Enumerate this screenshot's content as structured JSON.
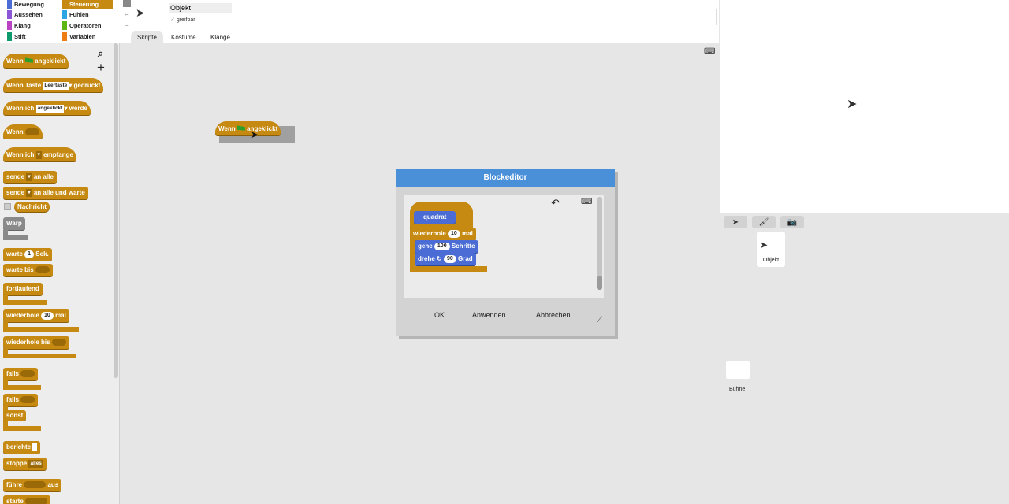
{
  "categories": [
    {
      "label": "Bewegung",
      "color": "#4a6cd4"
    },
    {
      "label": "Steuerung",
      "color": "#c68a12",
      "selected": true
    },
    {
      "label": "Aussehen",
      "color": "#8a55d7"
    },
    {
      "label": "Fühlen",
      "color": "#2ca5e2"
    },
    {
      "label": "Klang",
      "color": "#bb42c3"
    },
    {
      "label": "Operatoren",
      "color": "#5cb712"
    },
    {
      "label": "Stift",
      "color": "#0e9a6c"
    },
    {
      "label": "Variablen",
      "color": "#ee7d16"
    }
  ],
  "sprite": {
    "name": "Objekt",
    "draggable_label": "greifbar"
  },
  "tabs": [
    "Skripte",
    "Kostüme",
    "Klänge"
  ],
  "palette": {
    "when_flag": {
      "pre": "Wenn",
      "post": "angeklickt"
    },
    "when_key": {
      "pre": "Wenn Taste",
      "key": "Leertaste",
      "post": "gedrückt"
    },
    "when_clicked": {
      "pre": "Wenn ich",
      "opt": "angeklickt",
      "post": "werde"
    },
    "when": "Wenn",
    "when_receive": {
      "pre": "Wenn ich",
      "post": "empfange"
    },
    "broadcast": {
      "pre": "sende",
      "post": "an alle"
    },
    "broadcast_wait": {
      "pre": "sende",
      "post": "an alle und warte"
    },
    "message": "Nachricht",
    "warp": "Warp",
    "wait": {
      "pre": "warte",
      "num": "1",
      "post": "Sek."
    },
    "wait_until": "warte bis",
    "forever": "fortlaufend",
    "repeat": {
      "pre": "wiederhole",
      "num": "10",
      "post": "mal"
    },
    "repeat_until": "wiederhole bis",
    "if": "falls",
    "if_else": {
      "if": "falls",
      "else": "sonst"
    },
    "report": "berichte",
    "stop": {
      "pre": "stoppe",
      "opt": "alles"
    },
    "run": {
      "pre": "führe",
      "post": "aus"
    },
    "launch": "starte"
  },
  "script_block": {
    "pre": "Wenn",
    "post": "angeklickt"
  },
  "dialog": {
    "title": "Blockeditor",
    "prototype": "quadrat",
    "repeat": {
      "pre": "wiederhole",
      "num": "10",
      "post": "mal"
    },
    "move": {
      "pre": "gehe",
      "num": "100",
      "post": "Schritte"
    },
    "turn": {
      "pre": "drehe",
      "num": "90",
      "post": "Grad"
    },
    "ok": "OK",
    "apply": "Anwenden",
    "cancel": "Abbrechen"
  },
  "corral": {
    "sprite_label": "Objekt",
    "stage_label": "Bühne"
  },
  "colors": {
    "control": "#c68a12",
    "motion": "#4a6cd4",
    "title_bar": "#4a90d9"
  }
}
